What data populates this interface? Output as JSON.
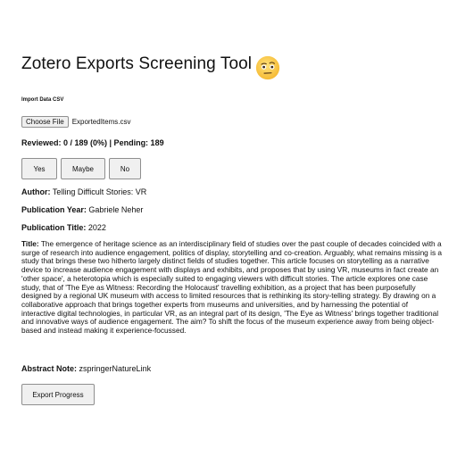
{
  "app": {
    "title": "Zotero Exports Screening Tool",
    "title_emoji": "face-with-raised-eyebrow"
  },
  "import": {
    "label": "Import Data CSV",
    "choose_file_label": "Choose File",
    "file_name": "ExportedItems.csv"
  },
  "status": {
    "text": "Reviewed: 0 / 189 (0%) | Pending: 189"
  },
  "decision": {
    "yes_label": "Yes",
    "maybe_label": "Maybe",
    "no_label": "No"
  },
  "record": {
    "author_label": "Author:",
    "author_value": "Telling Difficult Stories: VR",
    "year_label": "Publication Year:",
    "year_value": "Gabriele Neher",
    "pubtitle_label": "Publication Title:",
    "pubtitle_value": "2022",
    "title_label": "Title:",
    "title_value": "The emergence of heritage science as an interdisciplinary field of studies over the past couple of decades coincided with a surge of research into audience engagement, politics of display, storytelling and co-creation. Arguably, what remains missing is a study that brings these two hitherto largely distinct fields of studies together. This article focuses on storytelling as a narrative device to increase audience engagement with displays and exhibits, and proposes that by using VR, museums in fact create an 'other space', a heterotopia which is especially suited to engaging viewers with difficult stories. The article explores one case study, that of 'The Eye as Witness: Recording the Holocaust' travelling exhibition, as a project that has been purposefully designed by a regional UK museum with access to limited resources that is rethinking its story-telling strategy. By drawing on a collaborative approach that brings together experts from museums and universities, and by harnessing the potential of interactive digital technologies, in particular VR, as an integral part of its design, 'The Eye as Witness' brings together traditional and innovative ways of audience engagement. The aim? To shift the focus of the museum experience away from being object-based and instead making it experience-focussed.",
    "abstract_label": "Abstract Note:",
    "abstract_value": "zspringerNatureLink"
  },
  "export": {
    "label": "Export Progress"
  }
}
